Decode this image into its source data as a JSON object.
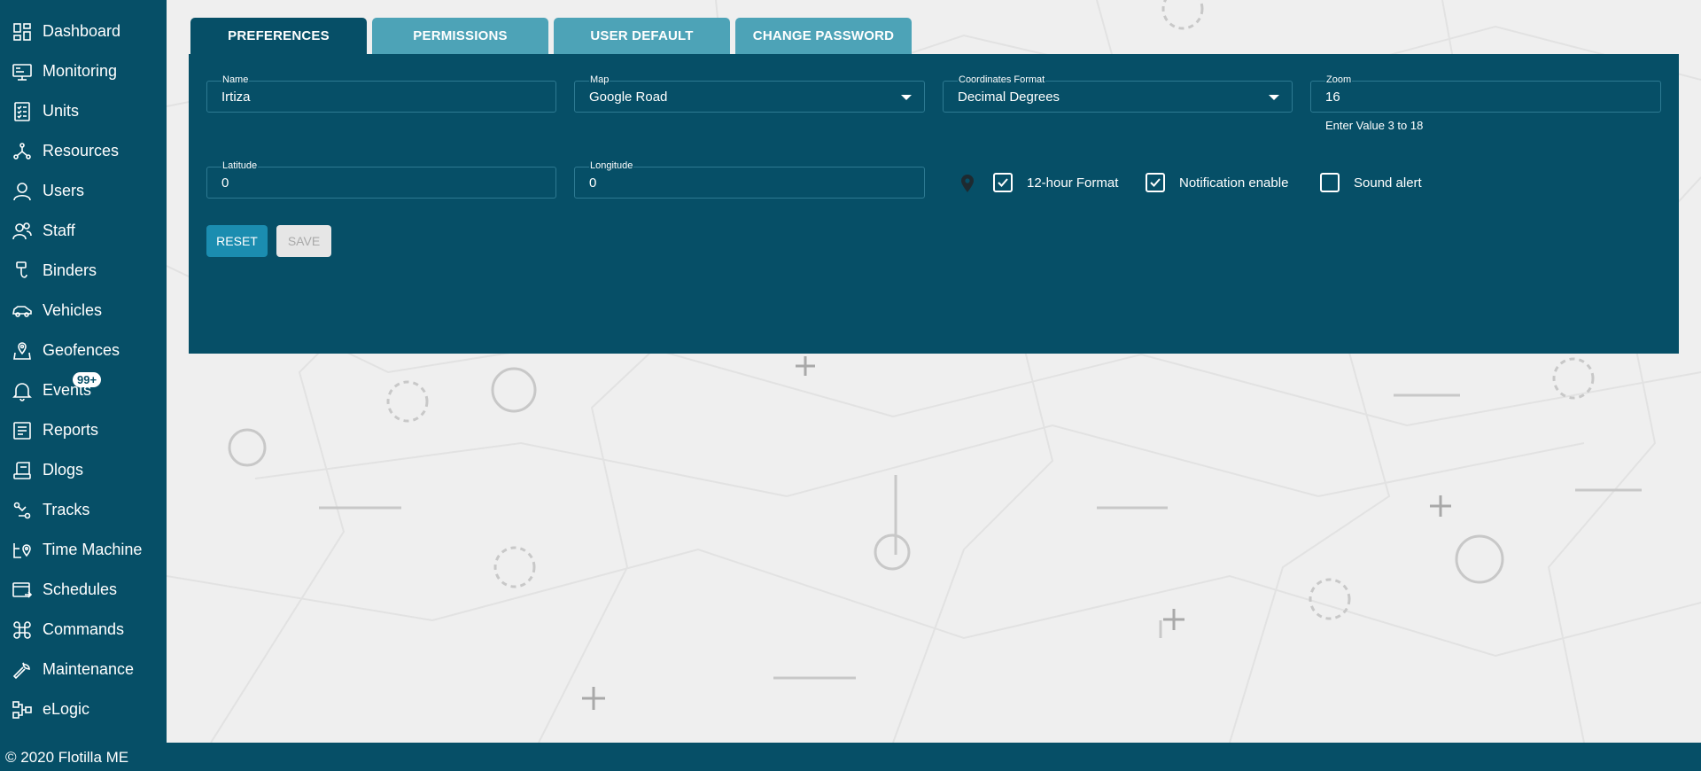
{
  "sidebar": {
    "items": [
      {
        "label": "Dashboard",
        "icon": "dashboard-icon"
      },
      {
        "label": "Monitoring",
        "icon": "monitor-icon"
      },
      {
        "label": "Units",
        "icon": "checklist-icon"
      },
      {
        "label": "Resources",
        "icon": "hub-icon"
      },
      {
        "label": "Users",
        "icon": "user-icon"
      },
      {
        "label": "Staff",
        "icon": "staff-icon"
      },
      {
        "label": "Binders",
        "icon": "binder-icon"
      },
      {
        "label": "Vehicles",
        "icon": "car-icon"
      },
      {
        "label": "Geofences",
        "icon": "geofence-icon"
      },
      {
        "label": "Events",
        "icon": "bell-icon",
        "badge": "99+"
      },
      {
        "label": "Reports",
        "icon": "report-icon"
      },
      {
        "label": "Dlogs",
        "icon": "dlog-icon"
      },
      {
        "label": "Tracks",
        "icon": "track-icon"
      },
      {
        "label": "Time Machine",
        "icon": "time-machine-icon"
      },
      {
        "label": "Schedules",
        "icon": "schedule-icon"
      },
      {
        "label": "Commands",
        "icon": "command-icon"
      },
      {
        "label": "Maintenance",
        "icon": "wrench-icon"
      },
      {
        "label": "eLogic",
        "icon": "logic-icon"
      }
    ]
  },
  "tabs": {
    "preferences": "PREFERENCES",
    "permissions": "PERMISSIONS",
    "user_default": "USER DEFAULT",
    "change_password": "CHANGE PASSWORD"
  },
  "form": {
    "name": {
      "label": "Name",
      "value": "Irtiza"
    },
    "map": {
      "label": "Map",
      "value": "Google Road"
    },
    "coordinates_format": {
      "label": "Coordinates Format",
      "value": "Decimal Degrees"
    },
    "zoom": {
      "label": "Zoom",
      "value": "16",
      "hint": "Enter Value 3 to 18"
    },
    "latitude": {
      "label": "Latitude",
      "value": "0"
    },
    "longitude": {
      "label": "Longitude",
      "value": "0"
    },
    "checkboxes": {
      "hour12": {
        "label": "12-hour Format",
        "checked": true
      },
      "notification": {
        "label": "Notification enable",
        "checked": true
      },
      "sound": {
        "label": "Sound alert",
        "checked": false
      }
    },
    "reset_label": "RESET",
    "save_label": "SAVE"
  },
  "footer": {
    "text": "© 2020 Flotilla ME"
  },
  "colors": {
    "primary": "#064f67",
    "tab_inactive": "#4da3b7",
    "button": "#1b8db0",
    "background": "#efefef"
  }
}
